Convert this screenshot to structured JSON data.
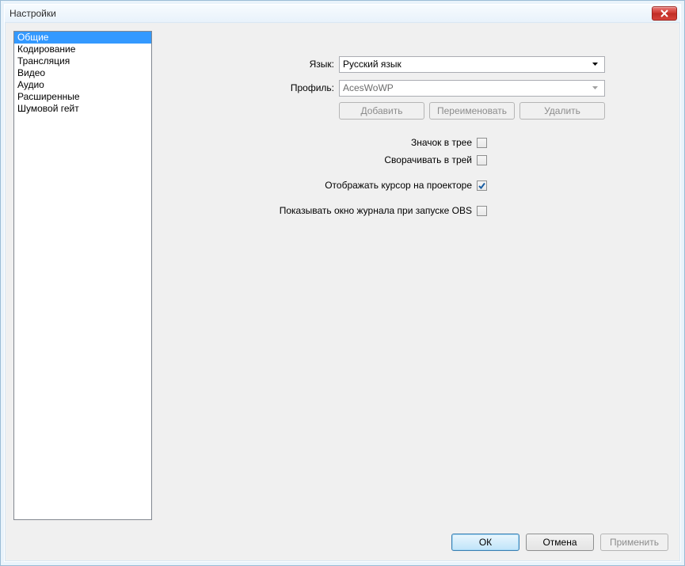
{
  "window": {
    "title": "Настройки"
  },
  "sidebar": {
    "items": [
      {
        "label": "Общие",
        "selected": true
      },
      {
        "label": "Кодирование",
        "selected": false
      },
      {
        "label": "Трансляция",
        "selected": false
      },
      {
        "label": "Видео",
        "selected": false
      },
      {
        "label": "Аудио",
        "selected": false
      },
      {
        "label": "Расширенные",
        "selected": false
      },
      {
        "label": "Шумовой гейт",
        "selected": false
      }
    ]
  },
  "settings": {
    "language_label": "Язык:",
    "language_value": "Русский язык",
    "profile_label": "Профиль:",
    "profile_value": "AcesWoWP",
    "add_btn": "Добавить",
    "rename_btn": "Переименовать",
    "delete_btn": "Удалить",
    "checkboxes": {
      "tray_icon": {
        "label": "Значок в трее",
        "checked": false
      },
      "minimize_tray": {
        "label": "Сворачивать в трей",
        "checked": false
      },
      "show_cursor": {
        "label": "Отображать курсор на проекторе",
        "checked": true
      },
      "show_log": {
        "label": "Показывать окно журнала при запуске OBS",
        "checked": false
      }
    }
  },
  "footer": {
    "ok": "ОК",
    "cancel": "Отмена",
    "apply": "Применить"
  }
}
